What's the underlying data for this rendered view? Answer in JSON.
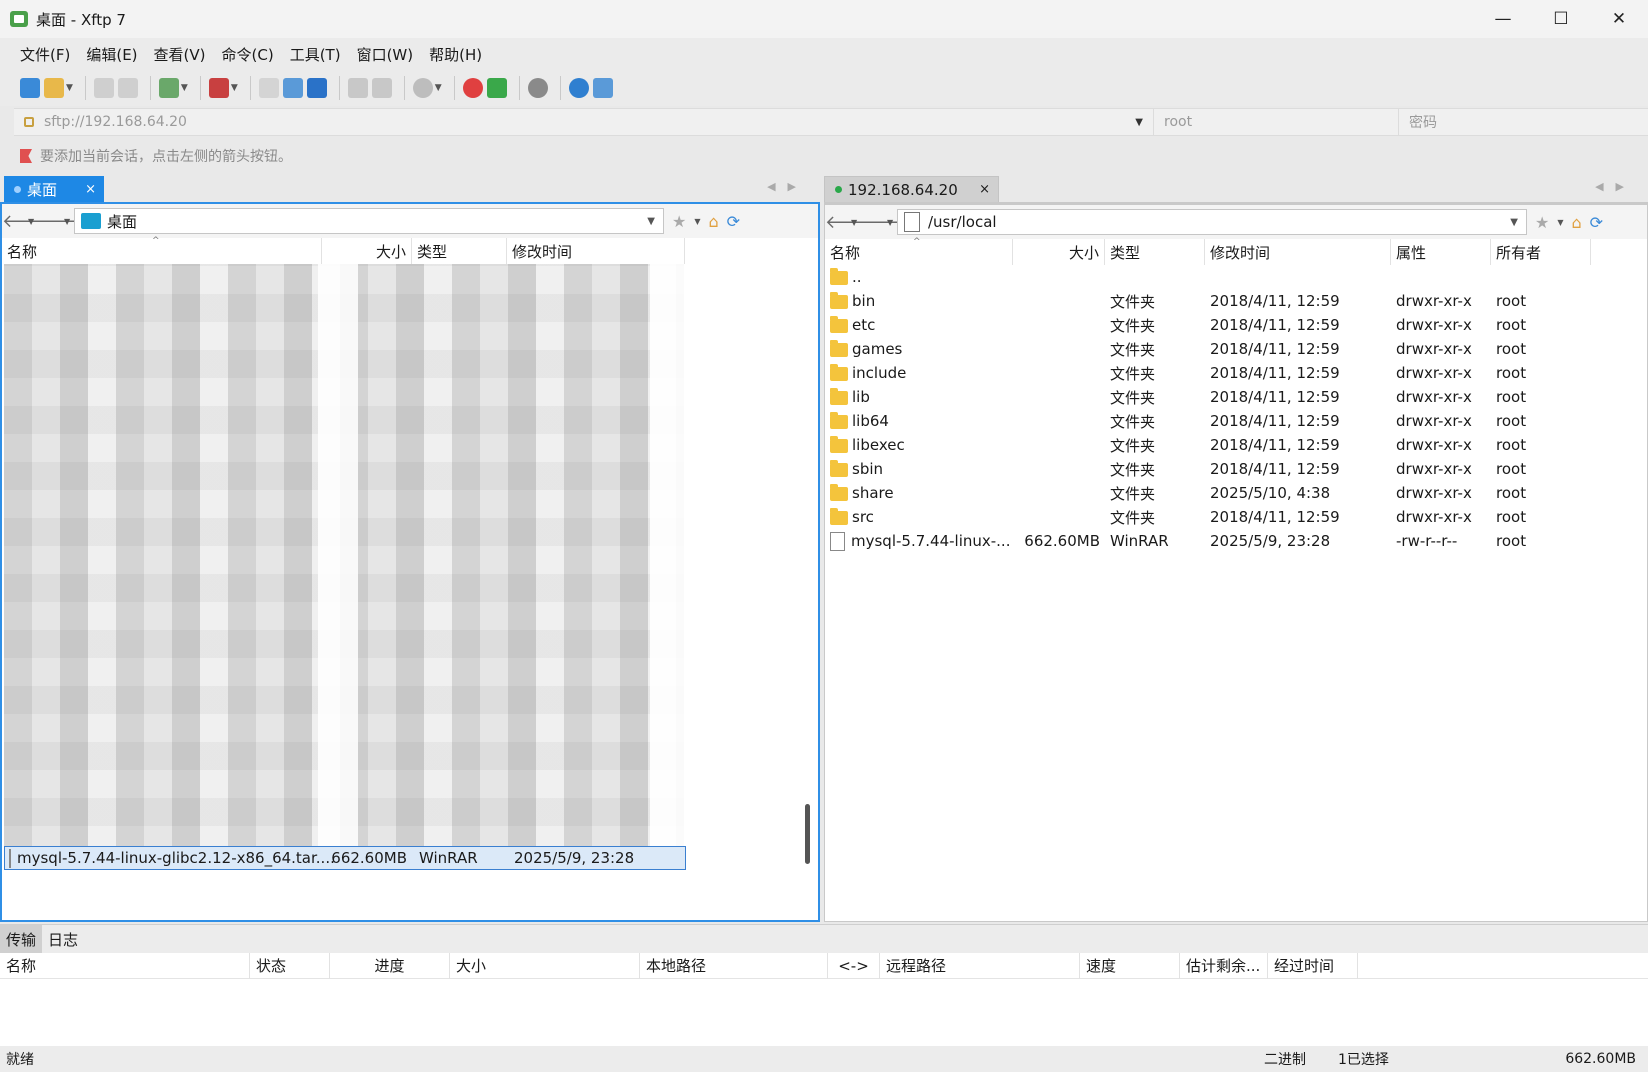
{
  "window": {
    "title": "桌面 - Xftp 7",
    "min": "—",
    "max": "☐",
    "close": "✕"
  },
  "menu": [
    "文件(F)",
    "编辑(E)",
    "查看(V)",
    "命令(C)",
    "工具(T)",
    "窗口(W)",
    "帮助(H)"
  ],
  "address": {
    "url_placeholder": "sftp://192.168.64.20",
    "user_placeholder": "root",
    "pwd_placeholder": "密码"
  },
  "hint": "要添加当前会话，点击左侧的箭头按钮。",
  "left": {
    "tab": "桌面",
    "path": "桌面",
    "columns": [
      "名称",
      "大小",
      "类型",
      "修改时间"
    ],
    "selected": {
      "name": "mysql-5.7.44-linux-glibc2.12-x86_64.tar....",
      "size": "662.60MB",
      "type": "WinRAR",
      "mtime": "2025/5/9, 23:28"
    }
  },
  "right": {
    "tab": "192.168.64.20",
    "path": "/usr/local",
    "columns": [
      "名称",
      "大小",
      "类型",
      "修改时间",
      "属性",
      "所有者"
    ],
    "rows": [
      {
        "icon": "folder",
        "name": "..",
        "size": "",
        "type": "",
        "mtime": "",
        "attr": "",
        "owner": ""
      },
      {
        "icon": "folder",
        "name": "bin",
        "size": "",
        "type": "文件夹",
        "mtime": "2018/4/11, 12:59",
        "attr": "drwxr-xr-x",
        "owner": "root"
      },
      {
        "icon": "folder",
        "name": "etc",
        "size": "",
        "type": "文件夹",
        "mtime": "2018/4/11, 12:59",
        "attr": "drwxr-xr-x",
        "owner": "root"
      },
      {
        "icon": "folder",
        "name": "games",
        "size": "",
        "type": "文件夹",
        "mtime": "2018/4/11, 12:59",
        "attr": "drwxr-xr-x",
        "owner": "root"
      },
      {
        "icon": "folder",
        "name": "include",
        "size": "",
        "type": "文件夹",
        "mtime": "2018/4/11, 12:59",
        "attr": "drwxr-xr-x",
        "owner": "root"
      },
      {
        "icon": "folder",
        "name": "lib",
        "size": "",
        "type": "文件夹",
        "mtime": "2018/4/11, 12:59",
        "attr": "drwxr-xr-x",
        "owner": "root"
      },
      {
        "icon": "folder",
        "name": "lib64",
        "size": "",
        "type": "文件夹",
        "mtime": "2018/4/11, 12:59",
        "attr": "drwxr-xr-x",
        "owner": "root"
      },
      {
        "icon": "folder",
        "name": "libexec",
        "size": "",
        "type": "文件夹",
        "mtime": "2018/4/11, 12:59",
        "attr": "drwxr-xr-x",
        "owner": "root"
      },
      {
        "icon": "folder",
        "name": "sbin",
        "size": "",
        "type": "文件夹",
        "mtime": "2018/4/11, 12:59",
        "attr": "drwxr-xr-x",
        "owner": "root"
      },
      {
        "icon": "folder",
        "name": "share",
        "size": "",
        "type": "文件夹",
        "mtime": "2025/5/10, 4:38",
        "attr": "drwxr-xr-x",
        "owner": "root"
      },
      {
        "icon": "folder",
        "name": "src",
        "size": "",
        "type": "文件夹",
        "mtime": "2018/4/11, 12:59",
        "attr": "drwxr-xr-x",
        "owner": "root"
      },
      {
        "icon": "file",
        "name": "mysql-5.7.44-linux-...",
        "size": "662.60MB",
        "type": "WinRAR",
        "mtime": "2025/5/9, 23:28",
        "attr": "-rw-r--r--",
        "owner": "root"
      }
    ]
  },
  "bottom": {
    "tabs": [
      "传输",
      "日志"
    ],
    "columns": [
      "名称",
      "状态",
      "进度",
      "大小",
      "本地路径",
      "<->",
      "远程路径",
      "速度",
      "估计剩余...",
      "经过时间"
    ]
  },
  "status": {
    "left": "就绪",
    "mode": "二进制",
    "selection": "1已选择",
    "size": "662.60MB"
  },
  "colors": {
    "accent": "#1e88e5",
    "folder": "#f4c43c",
    "selection": "#dbe9f8"
  }
}
